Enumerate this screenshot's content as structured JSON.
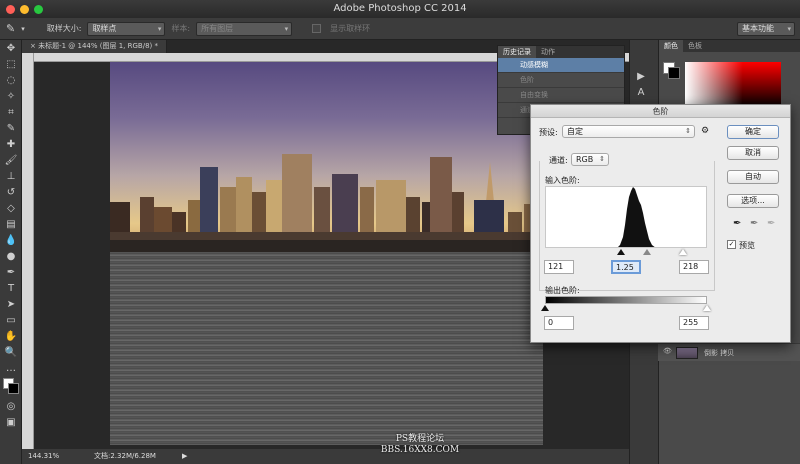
{
  "app": {
    "title": "Adobe Photoshop CC 2014"
  },
  "options_bar": {
    "sample_size_label": "取样大小:",
    "sample_size_value": "取样点",
    "sample_label": "样本:",
    "sample_value": "所有图层",
    "show_ring_label": "显示取样环",
    "workspace": "基本功能"
  },
  "document": {
    "tab_title": "未标题-1 @ 144% (图层 1, RGB/8) *",
    "zoom": "144.31%",
    "doc_size": "文档:2.32M/6.28M"
  },
  "history_panel": {
    "tabs": [
      "历史记录",
      "动作"
    ],
    "items": [
      "动感模糊",
      "色阶",
      "自由变换",
      "通道混合器"
    ]
  },
  "right_panel": {
    "tabs": [
      "颜色",
      "色板"
    ],
    "layer_name": "倒影 拷贝"
  },
  "levels": {
    "title": "色阶",
    "preset_label": "预设:",
    "preset_value": "自定",
    "channel_label": "通道:",
    "channel_value": "RGB",
    "input_label": "输入色阶:",
    "input_black": "121",
    "input_gamma": "1.25",
    "input_white": "218",
    "output_label": "输出色阶:",
    "output_black": "0",
    "output_white": "255",
    "buttons": {
      "ok": "确定",
      "cancel": "取消",
      "auto": "自动",
      "options": "选项..."
    },
    "preview_label": "预览"
  },
  "watermark": {
    "line1": "PS教程论坛",
    "line2": "BBS.16XX8.COM"
  },
  "colors": {
    "accent": "#5d7fa6",
    "panel": "#4a4a4a",
    "dialog": "#ececec"
  }
}
